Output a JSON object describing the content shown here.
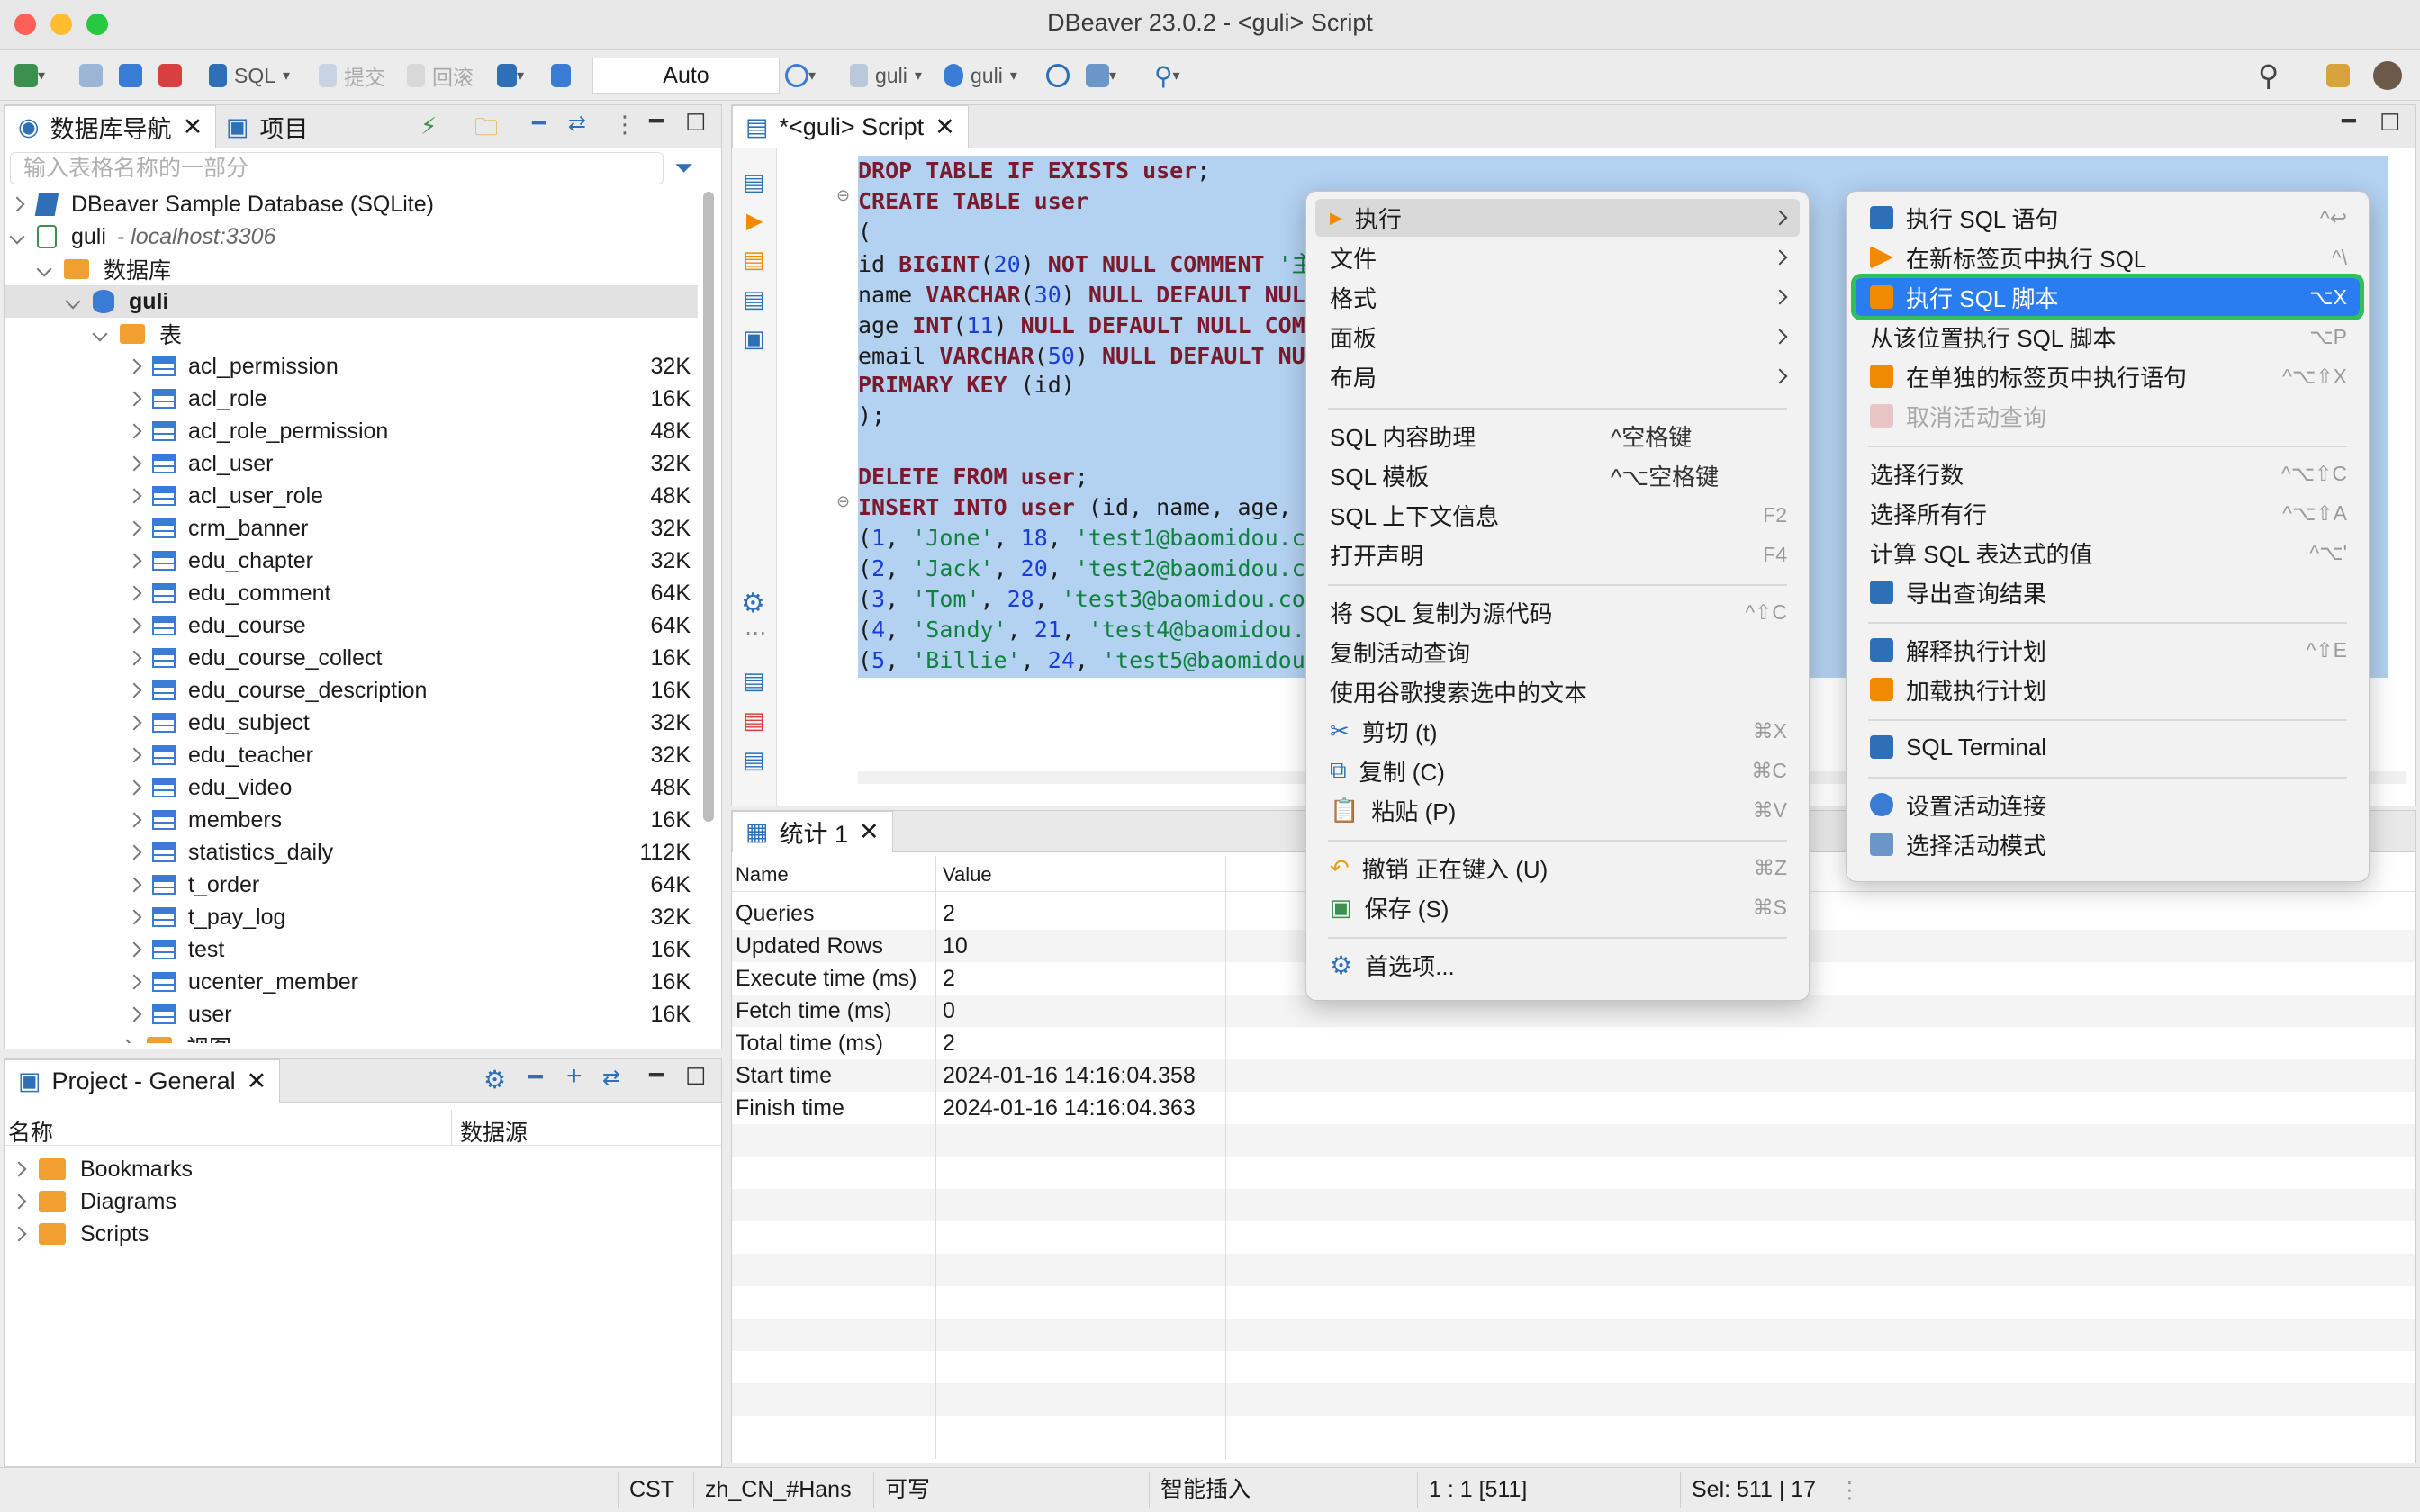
{
  "window": {
    "title": "DBeaver 23.0.2 - <guli> Script"
  },
  "toolbar": {
    "sql_label": "SQL",
    "commit_label": "提交",
    "rollback_label": "回滚",
    "transaction_mode": "Auto",
    "datasource1": "guli",
    "datasource2": "guli"
  },
  "navigator": {
    "tab_db": "数据库导航",
    "tab_project": "项目",
    "filter_placeholder": "输入表格名称的一部分",
    "sample_db": "DBeaver Sample Database (SQLite)",
    "conn_name": "guli",
    "conn_host": "- localhost:3306",
    "databases_label": "数据库",
    "db_name": "guli",
    "tables_label": "表",
    "tables": [
      {
        "name": "acl_permission",
        "size": "32K"
      },
      {
        "name": "acl_role",
        "size": "16K"
      },
      {
        "name": "acl_role_permission",
        "size": "48K"
      },
      {
        "name": "acl_user",
        "size": "32K"
      },
      {
        "name": "acl_user_role",
        "size": "48K"
      },
      {
        "name": "crm_banner",
        "size": "32K"
      },
      {
        "name": "edu_chapter",
        "size": "32K"
      },
      {
        "name": "edu_comment",
        "size": "64K"
      },
      {
        "name": "edu_course",
        "size": "64K"
      },
      {
        "name": "edu_course_collect",
        "size": "16K"
      },
      {
        "name": "edu_course_description",
        "size": "16K"
      },
      {
        "name": "edu_subject",
        "size": "32K"
      },
      {
        "name": "edu_teacher",
        "size": "32K"
      },
      {
        "name": "edu_video",
        "size": "48K"
      },
      {
        "name": "members",
        "size": "16K"
      },
      {
        "name": "statistics_daily",
        "size": "112K"
      },
      {
        "name": "t_order",
        "size": "64K"
      },
      {
        "name": "t_pay_log",
        "size": "32K"
      },
      {
        "name": "test",
        "size": "16K"
      },
      {
        "name": "ucenter_member",
        "size": "16K"
      },
      {
        "name": "user",
        "size": "16K"
      }
    ],
    "views_label": "视图"
  },
  "project": {
    "title": "Project - General",
    "col_name": "名称",
    "col_datasource": "数据源",
    "items": [
      "Bookmarks",
      "Diagrams",
      "Scripts"
    ]
  },
  "editor": {
    "tab_title": "*<guli> Script"
  },
  "results": {
    "tab": "统计 1",
    "col_name": "Name",
    "col_value": "Value",
    "rows": [
      {
        "name": "Queries",
        "value": "2"
      },
      {
        "name": "Updated Rows",
        "value": "10"
      },
      {
        "name": "Execute time (ms)",
        "value": "2"
      },
      {
        "name": "Fetch time (ms)",
        "value": "0"
      },
      {
        "name": "Total time (ms)",
        "value": "2"
      },
      {
        "name": "Start time",
        "value": "2024-01-16 14:16:04.358"
      },
      {
        "name": "Finish time",
        "value": "2024-01-16 14:16:04.363"
      }
    ]
  },
  "context_menu": {
    "execute": "执行",
    "file": "文件",
    "format": "格式",
    "panel": "面板",
    "layout": "布局",
    "assist": "SQL 内容助理",
    "assist_sc": "^空格键",
    "template": "SQL 模板",
    "template_sc": "^⌥空格键",
    "context_info": "SQL 上下文信息",
    "context_info_sc": "F2",
    "open_decl": "打开声明",
    "open_decl_sc": "F4",
    "copy_source": "将 SQL 复制为源代码",
    "copy_source_sc": "^⇧C",
    "copy_query": "复制活动查询",
    "google": "使用谷歌搜索选中的文本",
    "cut": "剪切 (t)",
    "cut_sc": "⌘X",
    "copy": "复制 (C)",
    "copy_sc": "⌘C",
    "paste": "粘贴 (P)",
    "paste_sc": "⌘V",
    "undo": "撤销 正在键入 (U)",
    "undo_sc": "⌘Z",
    "save": "保存 (S)",
    "save_sc": "⌘S",
    "prefs": "首选项..."
  },
  "submenu": {
    "exec_stmt": "执行 SQL 语句",
    "exec_stmt_sc": "^↩",
    "exec_new_tab": "在新标签页中执行 SQL",
    "exec_new_tab_sc": "^\\",
    "exec_script": "执行 SQL 脚本",
    "exec_script_sc": "⌥X",
    "exec_from_pos": "从该位置执行 SQL 脚本",
    "exec_from_pos_sc": "⌥P",
    "exec_separate": "在单独的标签页中执行语句",
    "exec_separate_sc": "^⌥⇧X",
    "cancel_query": "取消活动查询",
    "select_count": "选择行数",
    "select_count_sc": "^⌥⇧C",
    "select_all": "选择所有行",
    "select_all_sc": "^⌥⇧A",
    "eval_expr": "计算 SQL 表达式的值",
    "eval_expr_sc": "^⌥'",
    "export": "导出查询结果",
    "explain": "解释执行计划",
    "explain_sc": "^⇧E",
    "load_plan": "加载执行计划",
    "terminal": "SQL Terminal",
    "set_conn": "设置活动连接",
    "set_schema": "选择活动模式"
  },
  "status": {
    "tz": "CST",
    "locale": "zh_CN_#Hans",
    "writable": "可写",
    "insert_mode": "智能插入",
    "position": "1 : 1 [511]",
    "selection": "Sel: 511 | 17"
  }
}
